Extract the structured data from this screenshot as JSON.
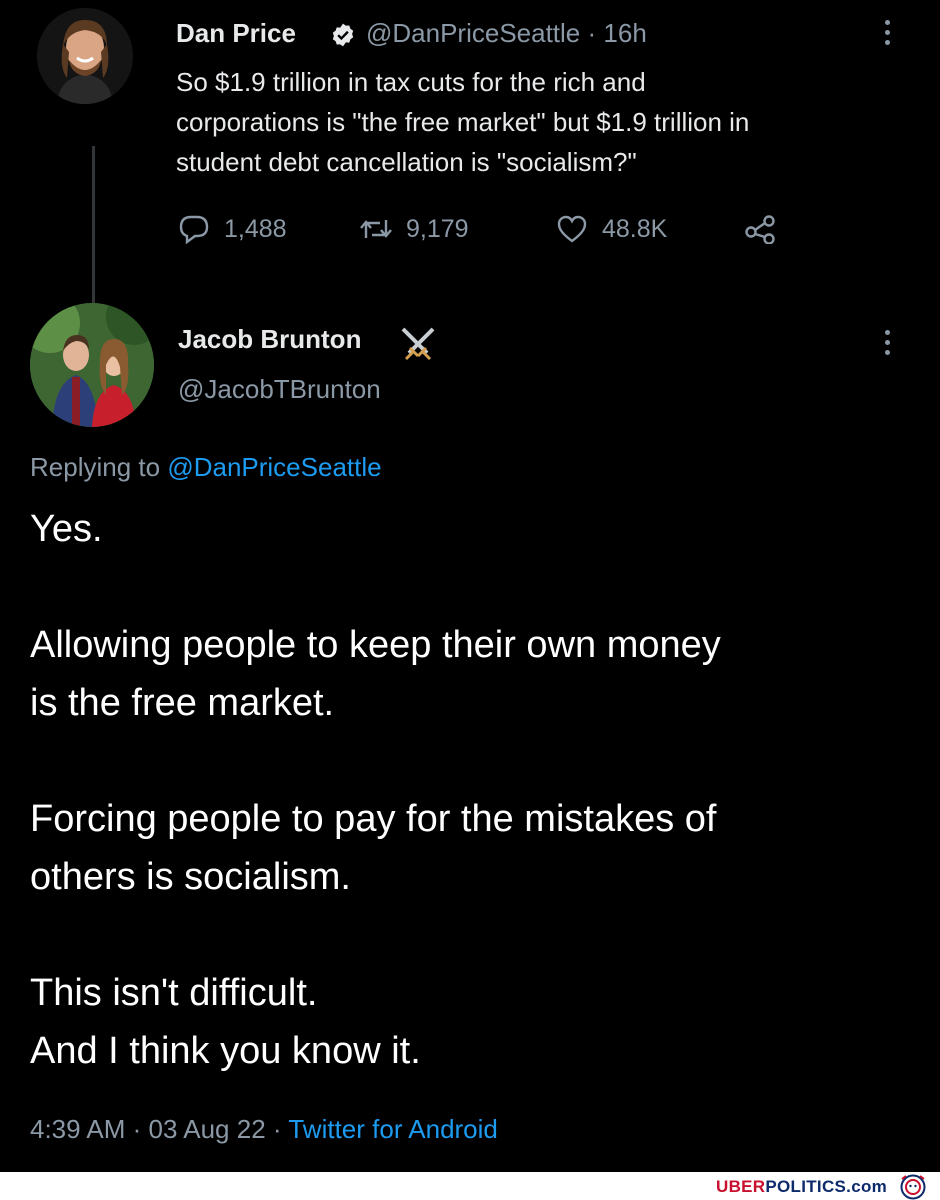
{
  "tweet": {
    "author_name": "Dan Price",
    "handle": "@DanPriceSeattle",
    "separator": "·",
    "time": "16h",
    "text_lines": [
      "So $1.9 trillion in tax cuts for the rich and",
      "corporations is \"the free market\" but $1.9 trillion in",
      "student debt cancellation is \"socialism?\""
    ],
    "replies": "1,488",
    "retweets": "9,179",
    "likes": "48.8K"
  },
  "reply": {
    "author_name": "Jacob Brunton",
    "handle": "@JacobTBrunton",
    "replying_prefix": "Replying to",
    "replying_to": "@DanPriceSeattle",
    "paragraphs": [
      [
        "Yes."
      ],
      [
        "Allowing people to keep their own money",
        "is the free market."
      ],
      [
        "Forcing people to pay for the mistakes of",
        "others is socialism."
      ],
      [
        "This isn't difficult.",
        "And I think you know it."
      ]
    ],
    "time": "4:39 AM",
    "date": "03 Aug 22",
    "separator": "·",
    "source": "Twitter for Android"
  },
  "watermark": {
    "brand_part1": "UBER",
    "brand_part2": "POLITICS",
    "brand_suffix": ".com"
  },
  "colors": {
    "background": "#000000",
    "primary_text": "#e7e9ea",
    "secondary_text": "#8b98a5",
    "link": "#1d9bf0",
    "verified": "#e7e9ea"
  },
  "icons": [
    "verified-badge-icon",
    "more-options-icon",
    "reply-icon",
    "retweet-icon",
    "like-icon",
    "share-icon",
    "crossed-swords-icon"
  ]
}
